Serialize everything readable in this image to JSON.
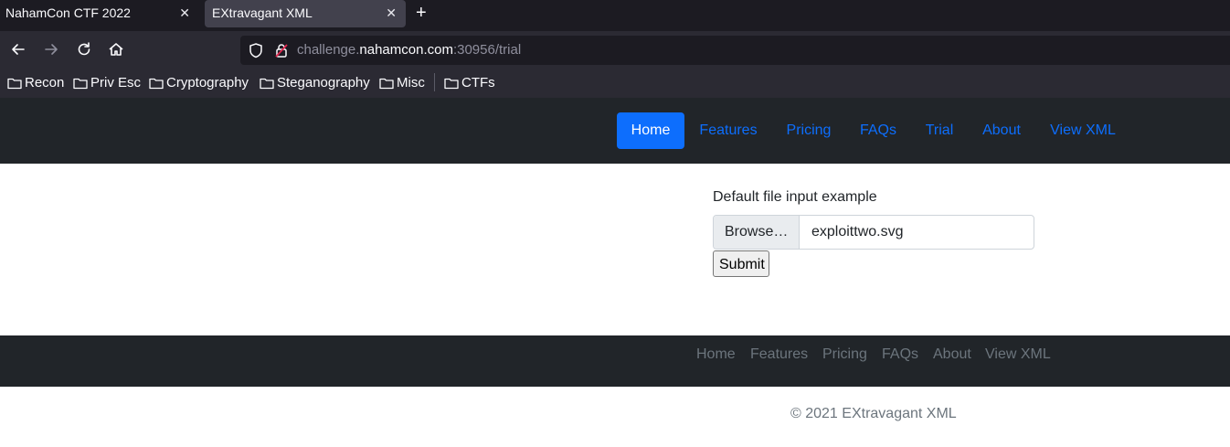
{
  "browser": {
    "tabs": [
      {
        "title": "NahamCon CTF 2022"
      },
      {
        "title": "EXtravagant XML"
      }
    ],
    "close_glyph": "✕",
    "new_tab_glyph": "+",
    "url": {
      "prefix": "challenge.",
      "domain": "nahamcon.com",
      "suffix": ":30956/trial"
    },
    "bookmarks": [
      "Recon",
      "Priv Esc",
      "Cryptography",
      "Steganography",
      "Misc",
      "CTFs"
    ]
  },
  "site_nav": {
    "links": [
      "Home",
      "Features",
      "Pricing",
      "FAQs",
      "Trial",
      "About",
      "View XML"
    ],
    "active": "Home",
    "colors": {
      "bg": "#212529",
      "link": "#0d6efd",
      "active_bg": "#0d6efd"
    }
  },
  "form": {
    "label": "Default file input example",
    "browse_label": "Browse…",
    "file_name": "exploittwo.svg",
    "submit_label": "Submit"
  },
  "footer": {
    "links": [
      "Home",
      "Features",
      "Pricing",
      "FAQs",
      "About",
      "View XML"
    ],
    "copyright": "© 2021 EXtravagant XML"
  }
}
